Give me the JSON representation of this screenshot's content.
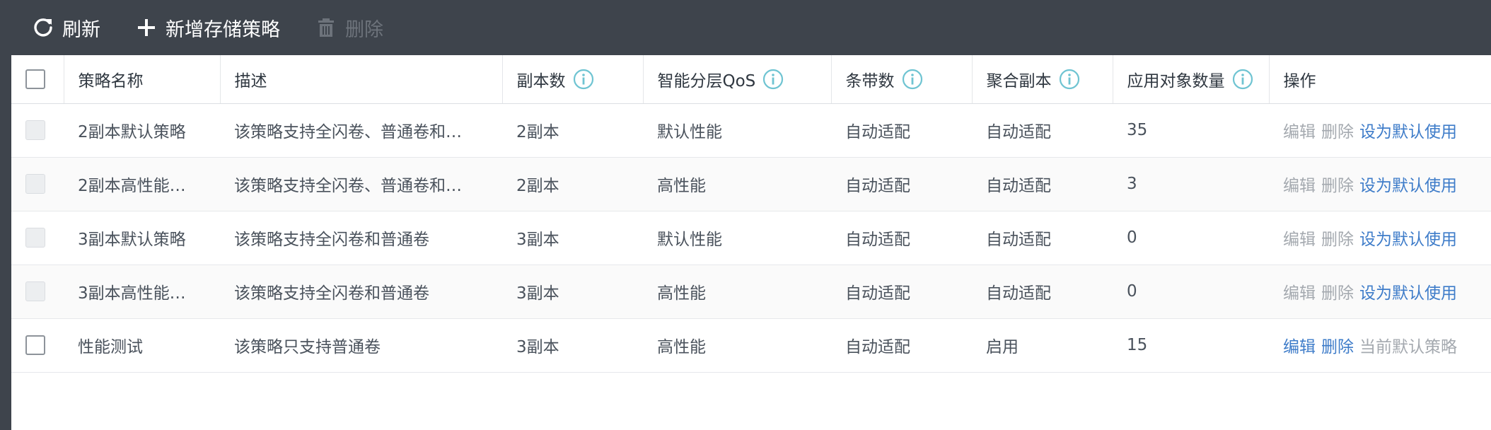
{
  "toolbar": {
    "refresh_label": "刷新",
    "add_label": "新增存储策略",
    "delete_label": "删除"
  },
  "table": {
    "headers": {
      "name": "策略名称",
      "desc": "描述",
      "replicas": "副本数",
      "qos": "智能分层QoS",
      "stripes": "条带数",
      "aggregate": "聚合副本",
      "app_count": "应用对象数量",
      "ops": "操作"
    },
    "rows": [
      {
        "name": "2副本默认策略",
        "desc": "该策略支持全闪卷、普通卷和…",
        "replicas": "2副本",
        "qos": "默认性能",
        "stripes": "自动适配",
        "aggregate": "自动适配",
        "app_count": "35",
        "op1": "编辑",
        "op2": "删除",
        "op3": "设为默认使用"
      },
      {
        "name": "2副本高性能…",
        "desc": "该策略支持全闪卷、普通卷和…",
        "replicas": "2副本",
        "qos": "高性能",
        "stripes": "自动适配",
        "aggregate": "自动适配",
        "app_count": "3",
        "op1": "编辑",
        "op2": "删除",
        "op3": "设为默认使用"
      },
      {
        "name": "3副本默认策略",
        "desc": "该策略支持全闪卷和普通卷",
        "replicas": "3副本",
        "qos": "默认性能",
        "stripes": "自动适配",
        "aggregate": "自动适配",
        "app_count": "0",
        "op1": "编辑",
        "op2": "删除",
        "op3": "设为默认使用"
      },
      {
        "name": "3副本高性能…",
        "desc": "该策略支持全闪卷和普通卷",
        "replicas": "3副本",
        "qos": "高性能",
        "stripes": "自动适配",
        "aggregate": "自动适配",
        "app_count": "0",
        "op1": "编辑",
        "op2": "删除",
        "op3": "设为默认使用"
      },
      {
        "name": "性能测试",
        "desc": "该策略只支持普通卷",
        "replicas": "3副本",
        "qos": "高性能",
        "stripes": "自动适配",
        "aggregate": "启用",
        "app_count": "15",
        "op1": "编辑",
        "op2": "删除",
        "op3": "当前默认策略"
      }
    ]
  },
  "colors": {
    "toolbar_bg": "#3e444c",
    "link": "#3e7cc9",
    "disabled": "#a4a9af",
    "info_icon": "#6fc4d2"
  },
  "icons": {
    "refresh": "refresh-icon",
    "add": "plus-icon",
    "delete": "trash-icon",
    "info": "info-icon"
  }
}
